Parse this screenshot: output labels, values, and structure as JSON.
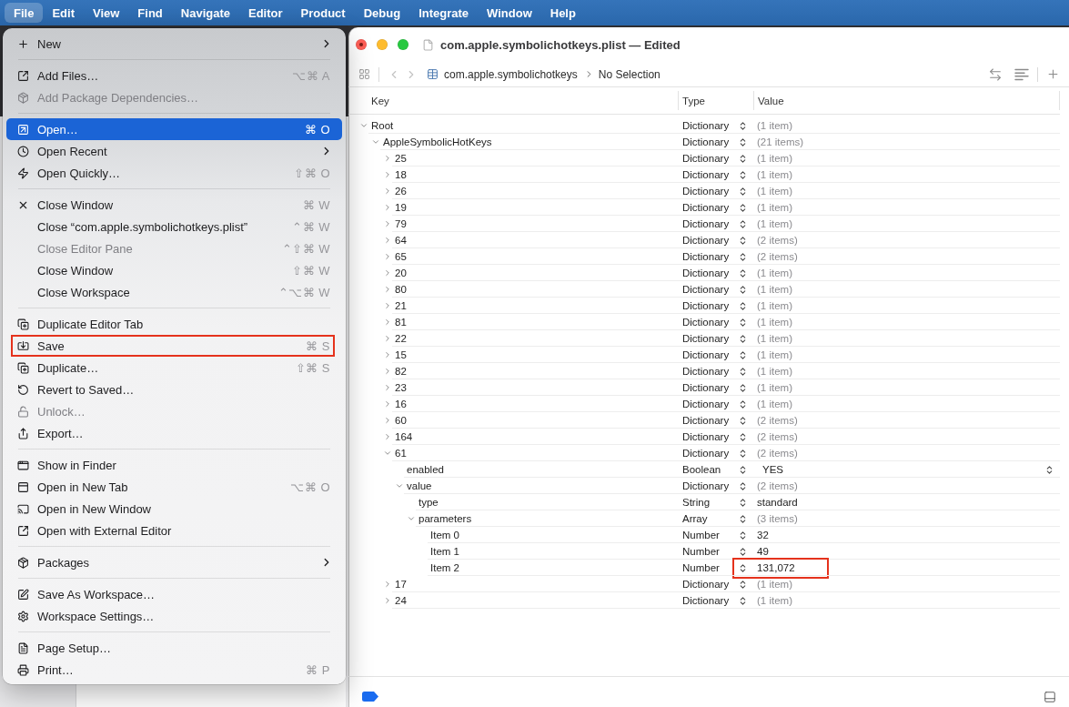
{
  "menu_bar": [
    {
      "label": "File",
      "selected": true
    },
    {
      "label": "Edit",
      "selected": false
    },
    {
      "label": "View",
      "selected": false
    },
    {
      "label": "Find",
      "selected": false
    },
    {
      "label": "Navigate",
      "selected": false
    },
    {
      "label": "Editor",
      "selected": false
    },
    {
      "label": "Product",
      "selected": false
    },
    {
      "label": "Debug",
      "selected": false
    },
    {
      "label": "Integrate",
      "selected": false
    },
    {
      "label": "Window",
      "selected": false
    },
    {
      "label": "Help",
      "selected": false
    }
  ],
  "file_menu": {
    "items": [
      {
        "kind": "item",
        "label": "New",
        "submenu": true,
        "disabled": false,
        "highlighted": false,
        "outlined": false
      },
      {
        "kind": "separator"
      },
      {
        "kind": "item",
        "label": "Add Files…",
        "shortcut": "⌥⌘ A",
        "submenu": false,
        "disabled": false,
        "highlighted": false,
        "outlined": false
      },
      {
        "kind": "item",
        "label": "Add Package Dependencies…",
        "submenu": false,
        "disabled": true,
        "highlighted": false,
        "outlined": false
      },
      {
        "kind": "separator"
      },
      {
        "kind": "item",
        "label": "Open…",
        "shortcut": "⌘ O",
        "submenu": false,
        "disabled": false,
        "highlighted": true,
        "outlined": false
      },
      {
        "kind": "item",
        "label": "Open Recent",
        "submenu": true,
        "disabled": false,
        "highlighted": false,
        "outlined": false
      },
      {
        "kind": "item",
        "label": "Open Quickly…",
        "shortcut": "⇧⌘ O",
        "submenu": false,
        "disabled": false,
        "highlighted": false,
        "outlined": false
      },
      {
        "kind": "separator"
      },
      {
        "kind": "item",
        "label": "Close Window",
        "shortcut": "⌘ W",
        "submenu": false,
        "disabled": false,
        "highlighted": false,
        "outlined": false
      },
      {
        "kind": "item",
        "label": "Close “com.apple.symbolichotkeys.plist”",
        "shortcut": "⌃⌘ W",
        "submenu": false,
        "disabled": false,
        "highlighted": false,
        "outlined": false
      },
      {
        "kind": "item",
        "label": "Close Editor Pane",
        "shortcut": "⌃⇧⌘ W",
        "submenu": false,
        "disabled": true,
        "highlighted": false,
        "outlined": false
      },
      {
        "kind": "item",
        "label": "Close Window",
        "shortcut": "⇧⌘ W",
        "submenu": false,
        "disabled": false,
        "highlighted": false,
        "outlined": false
      },
      {
        "kind": "item",
        "label": "Close Workspace",
        "shortcut": "⌃⌥⌘ W",
        "submenu": false,
        "disabled": false,
        "highlighted": false,
        "outlined": false
      },
      {
        "kind": "separator"
      },
      {
        "kind": "item",
        "label": "Duplicate Editor Tab",
        "submenu": false,
        "disabled": false,
        "highlighted": false,
        "outlined": false
      },
      {
        "kind": "item",
        "label": "Save",
        "shortcut": "⌘ S",
        "submenu": false,
        "disabled": false,
        "highlighted": false,
        "outlined": true
      },
      {
        "kind": "item",
        "label": "Duplicate…",
        "shortcut": "⇧⌘ S",
        "submenu": false,
        "disabled": false,
        "highlighted": false,
        "outlined": false
      },
      {
        "kind": "item",
        "label": "Revert to Saved…",
        "submenu": false,
        "disabled": false,
        "highlighted": false,
        "outlined": false
      },
      {
        "kind": "item",
        "label": "Unlock…",
        "submenu": false,
        "disabled": true,
        "highlighted": false,
        "outlined": false
      },
      {
        "kind": "item",
        "label": "Export…",
        "submenu": false,
        "disabled": false,
        "highlighted": false,
        "outlined": false
      },
      {
        "kind": "separator"
      },
      {
        "kind": "item",
        "label": "Show in Finder",
        "submenu": false,
        "disabled": false,
        "highlighted": false,
        "outlined": false
      },
      {
        "kind": "item",
        "label": "Open in New Tab",
        "shortcut": "⌥⌘ O",
        "submenu": false,
        "disabled": false,
        "highlighted": false,
        "outlined": false
      },
      {
        "kind": "item",
        "label": "Open in New Window",
        "submenu": false,
        "disabled": false,
        "highlighted": false,
        "outlined": false
      },
      {
        "kind": "item",
        "label": "Open with External Editor",
        "submenu": false,
        "disabled": false,
        "highlighted": false,
        "outlined": false
      },
      {
        "kind": "separator"
      },
      {
        "kind": "item",
        "label": "Packages",
        "submenu": true,
        "disabled": false,
        "highlighted": false,
        "outlined": false
      },
      {
        "kind": "separator"
      },
      {
        "kind": "item",
        "label": "Save As Workspace…",
        "submenu": false,
        "disabled": false,
        "highlighted": false,
        "outlined": false
      },
      {
        "kind": "item",
        "label": "Workspace Settings…",
        "submenu": false,
        "disabled": false,
        "highlighted": false,
        "outlined": false
      },
      {
        "kind": "separator"
      },
      {
        "kind": "item",
        "label": "Page Setup…",
        "submenu": false,
        "disabled": false,
        "highlighted": false,
        "outlined": false
      },
      {
        "kind": "item",
        "label": "Print…",
        "shortcut": "⌘ P",
        "submenu": false,
        "disabled": false,
        "highlighted": false,
        "outlined": false
      }
    ]
  },
  "window": {
    "title": "com.apple.symbolichotkeys.plist — Edited",
    "unsaved_changes": true,
    "breadcrumb": [
      "com.apple.symbolichotkeys",
      "No Selection"
    ],
    "columns": [
      "Key",
      "Type",
      "Value"
    ],
    "tree": [
      {
        "key": "Root",
        "type": "Dictionary",
        "value": "(1 item)",
        "kind": "collection",
        "expanded": true,
        "outlined": false,
        "children": [
          {
            "key": "AppleSymbolicHotKeys",
            "type": "Dictionary",
            "value": "(21 items)",
            "kind": "collection",
            "expanded": true,
            "outlined": false,
            "children": [
              {
                "key": "25",
                "type": "Dictionary",
                "value": "(1 item)",
                "kind": "collection",
                "expanded": false,
                "outlined": false
              },
              {
                "key": "18",
                "type": "Dictionary",
                "value": "(1 item)",
                "kind": "collection",
                "expanded": false,
                "outlined": false
              },
              {
                "key": "26",
                "type": "Dictionary",
                "value": "(1 item)",
                "kind": "collection",
                "expanded": false,
                "outlined": false
              },
              {
                "key": "19",
                "type": "Dictionary",
                "value": "(1 item)",
                "kind": "collection",
                "expanded": false,
                "outlined": false
              },
              {
                "key": "79",
                "type": "Dictionary",
                "value": "(1 item)",
                "kind": "collection",
                "expanded": false,
                "outlined": false
              },
              {
                "key": "64",
                "type": "Dictionary",
                "value": "(2 items)",
                "kind": "collection",
                "expanded": false,
                "outlined": false
              },
              {
                "key": "65",
                "type": "Dictionary",
                "value": "(2 items)",
                "kind": "collection",
                "expanded": false,
                "outlined": false
              },
              {
                "key": "20",
                "type": "Dictionary",
                "value": "(1 item)",
                "kind": "collection",
                "expanded": false,
                "outlined": false
              },
              {
                "key": "80",
                "type": "Dictionary",
                "value": "(1 item)",
                "kind": "collection",
                "expanded": false,
                "outlined": false
              },
              {
                "key": "21",
                "type": "Dictionary",
                "value": "(1 item)",
                "kind": "collection",
                "expanded": false,
                "outlined": false
              },
              {
                "key": "81",
                "type": "Dictionary",
                "value": "(1 item)",
                "kind": "collection",
                "expanded": false,
                "outlined": false
              },
              {
                "key": "22",
                "type": "Dictionary",
                "value": "(1 item)",
                "kind": "collection",
                "expanded": false,
                "outlined": false
              },
              {
                "key": "15",
                "type": "Dictionary",
                "value": "(1 item)",
                "kind": "collection",
                "expanded": false,
                "outlined": false
              },
              {
                "key": "82",
                "type": "Dictionary",
                "value": "(1 item)",
                "kind": "collection",
                "expanded": false,
                "outlined": false
              },
              {
                "key": "23",
                "type": "Dictionary",
                "value": "(1 item)",
                "kind": "collection",
                "expanded": false,
                "outlined": false
              },
              {
                "key": "16",
                "type": "Dictionary",
                "value": "(1 item)",
                "kind": "collection",
                "expanded": false,
                "outlined": false
              },
              {
                "key": "60",
                "type": "Dictionary",
                "value": "(2 items)",
                "kind": "collection",
                "expanded": false,
                "outlined": false
              },
              {
                "key": "164",
                "type": "Dictionary",
                "value": "(2 items)",
                "kind": "collection",
                "expanded": false,
                "outlined": false
              },
              {
                "key": "61",
                "type": "Dictionary",
                "value": "(2 items)",
                "kind": "collection",
                "expanded": true,
                "outlined": false,
                "children": [
                  {
                    "key": "enabled",
                    "type": "Boolean",
                    "value": "YES",
                    "kind": "boolean",
                    "outlined": false
                  },
                  {
                    "key": "value",
                    "type": "Dictionary",
                    "value": "(2 items)",
                    "kind": "collection",
                    "expanded": true,
                    "outlined": false,
                    "children": [
                      {
                        "key": "type",
                        "type": "String",
                        "value": "standard",
                        "kind": "scalar",
                        "outlined": false
                      },
                      {
                        "key": "parameters",
                        "type": "Array",
                        "value": "(3 items)",
                        "kind": "collection",
                        "expanded": true,
                        "outlined": false,
                        "children": [
                          {
                            "key": "Item 0",
                            "type": "Number",
                            "value": "32",
                            "kind": "scalar",
                            "outlined": false
                          },
                          {
                            "key": "Item 1",
                            "type": "Number",
                            "value": "49",
                            "kind": "scalar",
                            "outlined": false
                          },
                          {
                            "key": "Item 2",
                            "type": "Number",
                            "value": "131,072",
                            "kind": "scalar",
                            "outlined": true
                          }
                        ]
                      }
                    ]
                  }
                ]
              },
              {
                "key": "17",
                "type": "Dictionary",
                "value": "(1 item)",
                "kind": "collection",
                "expanded": false,
                "outlined": false
              },
              {
                "key": "24",
                "type": "Dictionary",
                "value": "(1 item)",
                "kind": "collection",
                "expanded": false,
                "outlined": false
              }
            ]
          }
        ]
      }
    ]
  }
}
